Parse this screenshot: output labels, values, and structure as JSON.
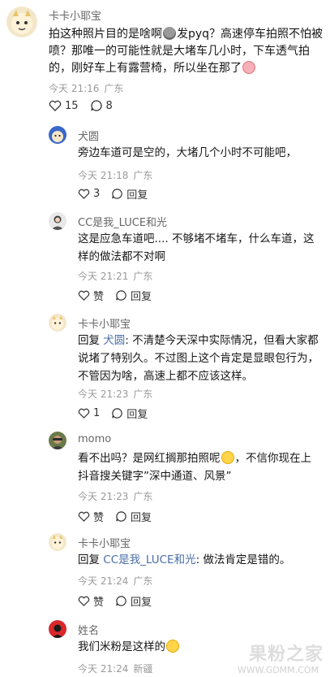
{
  "top": {
    "author": "卡卡小耶宝",
    "text_a": "拍这种照片目的是啥啊",
    "text_b": "发pyq？高速停车拍照不怕被喷？那唯一的可能性就是大堵车几小时，下车透气拍的，刚好车上有露营椅，所以坐在那了",
    "time": "今天 21:16",
    "location": "广东",
    "likes": "15",
    "comments": "8"
  },
  "replies": [
    {
      "author": "犬圆",
      "text": "旁边车道可是空的，大堵几个小时不可能吧，",
      "time": "今天 21:18",
      "location": "广东",
      "likes": "3",
      "reply_label": "回复"
    },
    {
      "author": "CC是我_LUCE和光",
      "text": "这是应急车道吧.... 不够堵不堵车，什么车道，这样的做法都不对啊",
      "time": "今天 21:21",
      "location": "广东",
      "like_label": "赞",
      "reply_label": "回复"
    },
    {
      "author": "卡卡小耶宝",
      "prefix": "回复",
      "mention": "犬圆",
      "text": ": 不清楚今天深中实际情况，但看大家都说堵了特别久。不过图上这个肯定是显眼包行为，不管因为啥，高速上都不应该这样。",
      "time": "今天 21:23",
      "location": "广东",
      "likes": "1",
      "reply_label": "回复"
    },
    {
      "author": "momo",
      "text_a": "看不出吗？是网红搁那拍照呢",
      "text_b": "，不信你现在上抖音搜关键字”深中通道、风景”",
      "time": "今天 21:23",
      "location": "广东",
      "like_label": "赞",
      "reply_label": "回复"
    },
    {
      "author": "卡卡小耶宝",
      "prefix": "回复",
      "mention": "CC是我_LUCE和光",
      "text": ": 做法肯定是错的。",
      "time": "今天 21:24",
      "location": "广东",
      "like_label": "赞",
      "reply_label": "回复"
    },
    {
      "author": "姓名",
      "text": "我们米粉是这样的",
      "time": "今天 21:24",
      "location": "新疆"
    }
  ],
  "watermark": {
    "text": "果粉之家",
    "url": "WWW.GDMM.COM"
  },
  "colors": {
    "link": "#4a6fa8",
    "meta": "#9a9a9a"
  }
}
